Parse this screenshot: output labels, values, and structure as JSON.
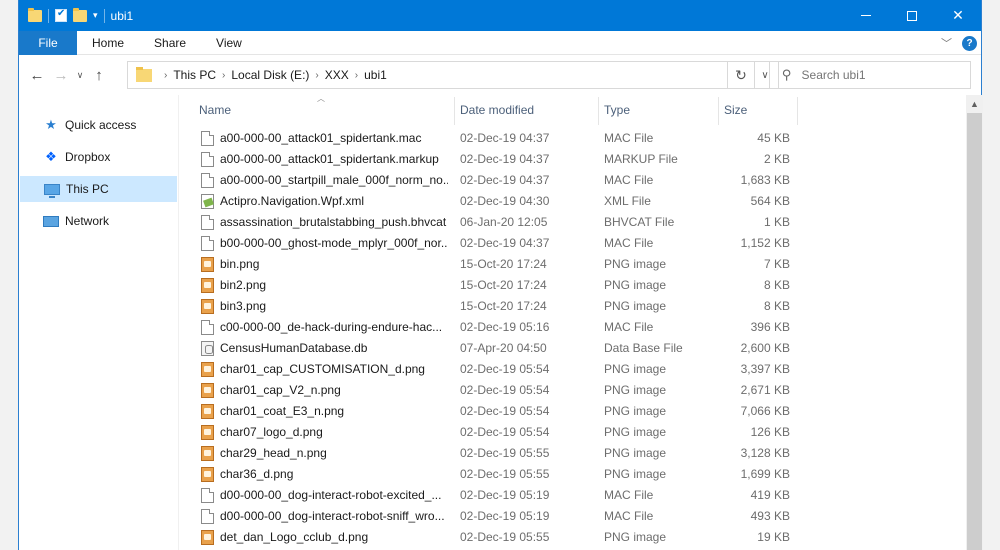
{
  "window": {
    "title": "ubi1"
  },
  "ribbon": {
    "file": "File",
    "tabs": [
      "Home",
      "Share",
      "View"
    ]
  },
  "address": {
    "crumbs": [
      "This PC",
      "Local Disk (E:)",
      "XXX",
      "ubi1"
    ]
  },
  "search": {
    "placeholder": "Search ubi1"
  },
  "sidebar": {
    "items": [
      {
        "label": "Quick access",
        "icon": "star-icon"
      },
      {
        "label": "Dropbox",
        "icon": "dropbox-icon"
      },
      {
        "label": "This PC",
        "icon": "computer-icon",
        "selected": true
      },
      {
        "label": "Network",
        "icon": "network-icon"
      }
    ]
  },
  "columns": {
    "name": "Name",
    "date": "Date modified",
    "type": "Type",
    "size": "Size"
  },
  "files": [
    {
      "name": "a00-000-00_attack01_spidertank.mac",
      "date": "02-Dec-19 04:37",
      "type": "MAC File",
      "size": "45 KB",
      "icon": "file"
    },
    {
      "name": "a00-000-00_attack01_spidertank.markup",
      "date": "02-Dec-19 04:37",
      "type": "MARKUP File",
      "size": "2 KB",
      "icon": "file"
    },
    {
      "name": "a00-000-00_startpill_male_000f_norm_no...",
      "date": "02-Dec-19 04:37",
      "type": "MAC File",
      "size": "1,683 KB",
      "icon": "file"
    },
    {
      "name": "Actipro.Navigation.Wpf.xml",
      "date": "02-Dec-19 04:30",
      "type": "XML File",
      "size": "564 KB",
      "icon": "xml"
    },
    {
      "name": "assassination_brutalstabbing_push.bhvcat",
      "date": "06-Jan-20 12:05",
      "type": "BHVCAT File",
      "size": "1 KB",
      "icon": "file"
    },
    {
      "name": "b00-000-00_ghost-mode_mplyr_000f_nor...",
      "date": "02-Dec-19 04:37",
      "type": "MAC File",
      "size": "1,152 KB",
      "icon": "file"
    },
    {
      "name": "bin.png",
      "date": "15-Oct-20 17:24",
      "type": "PNG image",
      "size": "7 KB",
      "icon": "png"
    },
    {
      "name": "bin2.png",
      "date": "15-Oct-20 17:24",
      "type": "PNG image",
      "size": "8 KB",
      "icon": "png"
    },
    {
      "name": "bin3.png",
      "date": "15-Oct-20 17:24",
      "type": "PNG image",
      "size": "8 KB",
      "icon": "png"
    },
    {
      "name": "c00-000-00_de-hack-during-endure-hac...",
      "date": "02-Dec-19 05:16",
      "type": "MAC File",
      "size": "396 KB",
      "icon": "file"
    },
    {
      "name": "CensusHumanDatabase.db",
      "date": "07-Apr-20 04:50",
      "type": "Data Base File",
      "size": "2,600 KB",
      "icon": "db"
    },
    {
      "name": "char01_cap_CUSTOMISATION_d.png",
      "date": "02-Dec-19 05:54",
      "type": "PNG image",
      "size": "3,397 KB",
      "icon": "png"
    },
    {
      "name": "char01_cap_V2_n.png",
      "date": "02-Dec-19 05:54",
      "type": "PNG image",
      "size": "2,671 KB",
      "icon": "png"
    },
    {
      "name": "char01_coat_E3_n.png",
      "date": "02-Dec-19 05:54",
      "type": "PNG image",
      "size": "7,066 KB",
      "icon": "png"
    },
    {
      "name": "char07_logo_d.png",
      "date": "02-Dec-19 05:54",
      "type": "PNG image",
      "size": "126 KB",
      "icon": "png"
    },
    {
      "name": "char29_head_n.png",
      "date": "02-Dec-19 05:55",
      "type": "PNG image",
      "size": "3,128 KB",
      "icon": "png"
    },
    {
      "name": "char36_d.png",
      "date": "02-Dec-19 05:55",
      "type": "PNG image",
      "size": "1,699 KB",
      "icon": "png"
    },
    {
      "name": "d00-000-00_dog-interact-robot-excited_...",
      "date": "02-Dec-19 05:19",
      "type": "MAC File",
      "size": "419 KB",
      "icon": "file"
    },
    {
      "name": "d00-000-00_dog-interact-robot-sniff_wro...",
      "date": "02-Dec-19 05:19",
      "type": "MAC File",
      "size": "493 KB",
      "icon": "file"
    },
    {
      "name": "det_dan_Logo_cclub_d.png",
      "date": "02-Dec-19 05:55",
      "type": "PNG image",
      "size": "19 KB",
      "icon": "png"
    }
  ]
}
